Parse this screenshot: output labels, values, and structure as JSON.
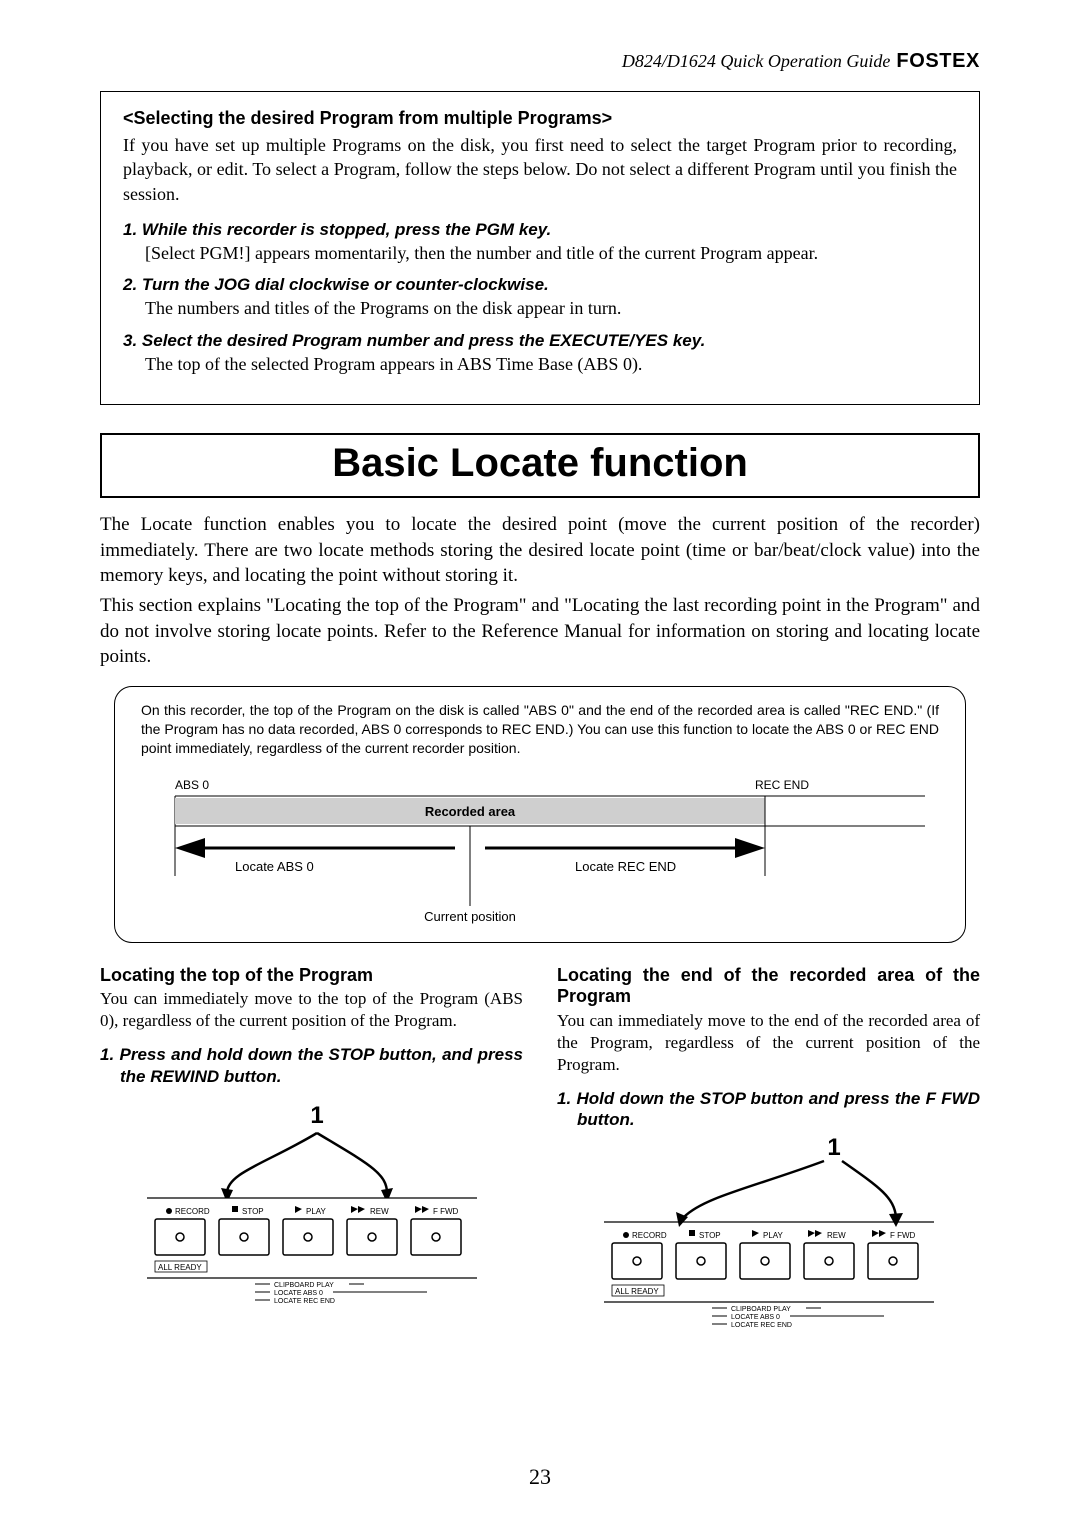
{
  "header": {
    "text": "D824/D1624 Quick Operation Guide",
    "brand": "FOSTEX"
  },
  "program_box": {
    "subtitle": "<Selecting the desired Program from multiple Programs>",
    "intro": "If you have set up multiple Programs on the disk, you first need to select the target Program prior to recording, playback, or edit.  To select a Program, follow the steps below.  Do not select a different Program until you finish the session.",
    "steps": [
      {
        "head": "1. While this recorder is stopped, press the PGM key.",
        "body": "[Select PGM!] appears momentarily, then the number and title of the current Program appear."
      },
      {
        "head": "2. Turn the JOG dial clockwise or counter-clockwise.",
        "body": "The numbers and titles of the Programs on the disk appear in turn."
      },
      {
        "head": "3. Select the desired Program number and press the EXECUTE/YES key.",
        "body": "The top of the selected Program appears in ABS Time Base (ABS 0)."
      }
    ]
  },
  "big_title": "Basic Locate function",
  "intro_paras": [
    "The Locate function enables you to locate the desired point (move the current position of the recorder) immediately.  There are two locate methods storing the desired locate point (time or bar/beat/clock value) into the memory keys, and locating the point without storing it.",
    "This section explains \"Locating the top of the Program\" and \"Locating the last recording point in the Program\" and do not involve storing locate points.  Refer to the Reference Manual for information on storing and locating locate points."
  ],
  "diagram": {
    "note": "On this recorder, the top of the Program on the disk is called \"ABS 0\" and the end of the recorded area is called \"REC END.\" (If the Program has no data recorded, ABS 0 corresponds to REC END.)  You can use this function to locate the ABS 0 or REC END point immediately, regardless of the current recorder position.",
    "labels": {
      "abs0": "ABS 0",
      "recend": "REC END",
      "recorded_area": "Recorded area",
      "locate_abs0": "Locate ABS 0",
      "locate_recend": "Locate REC END",
      "current_position": "Current position"
    }
  },
  "left_col": {
    "title": "Locating the top of the Program",
    "para": "You can immediately move to the top of the Program (ABS 0), regardless of the current position of the Program.",
    "step": "1.  Press and hold down the STOP button, and press the REWIND button."
  },
  "right_col": {
    "title": "Locating the end of the recorded area of the Program",
    "para": "You can immediately move to the end of the recorded area of the Program, regardless of the current position of the Program.",
    "step": "1.  Hold down the STOP button and press the F FWD button."
  },
  "transport": {
    "buttons": [
      "RECORD",
      "STOP",
      "PLAY",
      "REW",
      "F FWD"
    ],
    "labels": [
      "CLIPBOARD PLAY",
      "LOCATE ABS 0",
      "LOCATE REC END"
    ],
    "all_ready": "ALL READY",
    "callout": "1"
  },
  "page_number": "23"
}
